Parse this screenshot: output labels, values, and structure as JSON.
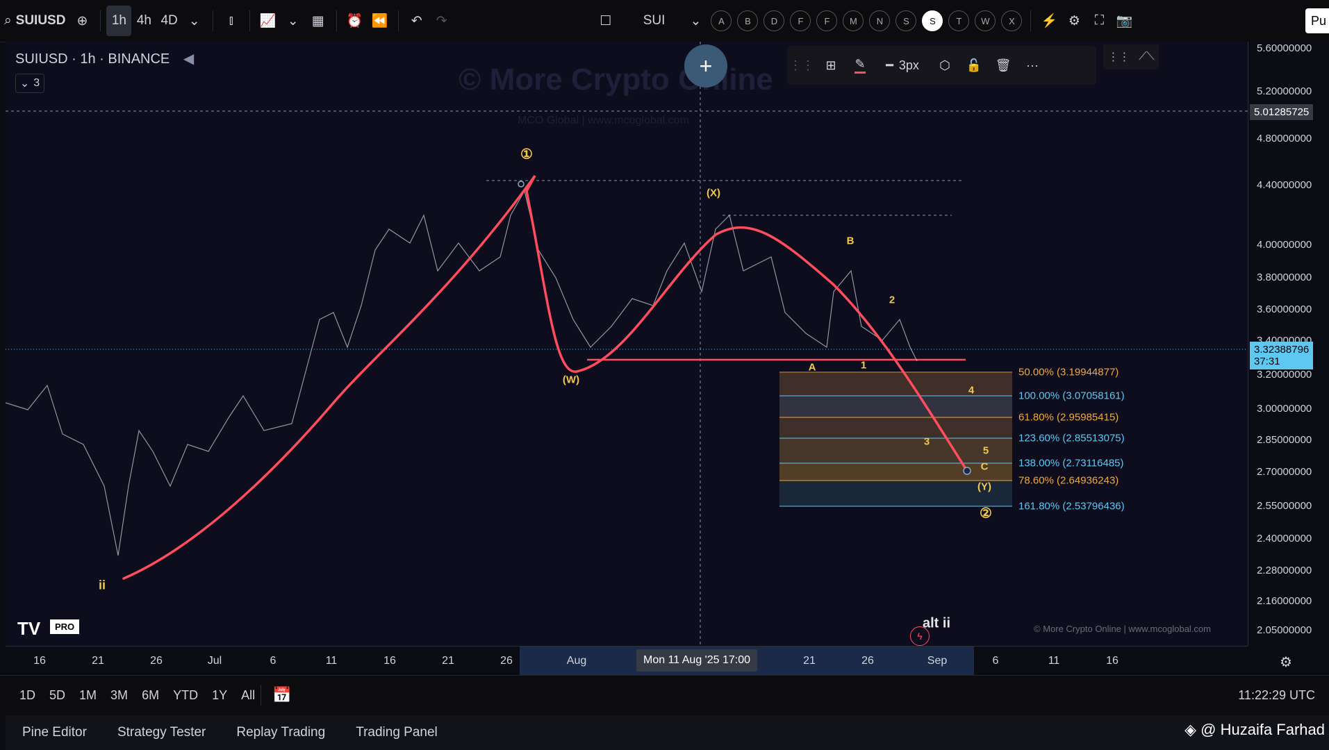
{
  "topbar": {
    "symbol": "SUIUSD",
    "intervals": [
      "1h",
      "4h",
      "4D"
    ],
    "active_interval": "1h",
    "symbol_short": "SUI",
    "letters": [
      "A",
      "B",
      "D",
      "F",
      "F",
      "M",
      "N",
      "S",
      "S",
      "T",
      "W",
      "X"
    ],
    "selected_letter_index": 8,
    "publish": "Pu"
  },
  "legend": {
    "title": "SUIUSD · 1h · BINANCE",
    "collapse": "3"
  },
  "drawing_toolbar": {
    "width_label": "3px"
  },
  "watermark": {
    "main": "© More Crypto Online",
    "sub": "MCO Global  |  www.mcoglobal.com"
  },
  "price_axis": {
    "ticks": [
      "5.60000000",
      "5.20000000",
      "4.80000000",
      "4.40000000",
      "4.00000000",
      "3.80000000",
      "3.60000000",
      "3.40000000",
      "3.20000000",
      "3.00000000",
      "2.85000000",
      "2.70000000",
      "2.55000000",
      "2.40000000",
      "2.28000000",
      "2.16000000",
      "2.05000000"
    ],
    "crosshair_price": "5.01285725",
    "last_price": "3.32388796",
    "countdown": "37:31"
  },
  "time_axis": {
    "ticks": [
      "16",
      "21",
      "26",
      "Jul",
      "6",
      "11",
      "16",
      "21",
      "26",
      "Aug",
      "21",
      "26",
      "Sep",
      "6",
      "11",
      "16"
    ],
    "crosshair_label": "Mon 11 Aug '25   17:00"
  },
  "waves": {
    "w1": "①",
    "w2": "②",
    "X": "(X)",
    "W": "(W)",
    "Y": "(Y)",
    "B": "B",
    "A": "A",
    "C": "C",
    "n1": "1",
    "n2": "2",
    "n3": "3",
    "n4": "4",
    "n5": "5",
    "ii": "ii",
    "alt": "alt ii"
  },
  "fib_levels": [
    {
      "label": "50.00% (3.19944877)",
      "color": "#f2a93b"
    },
    {
      "label": "100.00% (3.07058161)",
      "color": "#5ec8f2"
    },
    {
      "label": "61.80% (2.95985415)",
      "color": "#f2a93b"
    },
    {
      "label": "123.60% (2.85513075)",
      "color": "#5ec8f2"
    },
    {
      "label": "138.00% (2.73116485)",
      "color": "#5ec8f2"
    },
    {
      "label": "78.60% (2.64936243)",
      "color": "#f2a93b"
    },
    {
      "label": "161.80% (2.53796436)",
      "color": "#5ec8f2"
    }
  ],
  "chart_footer": {
    "copyright": "© More Crypto Online  |  www.mcoglobal.com",
    "logo": "TV",
    "pro": "PRO"
  },
  "range_bar": {
    "ranges": [
      "1D",
      "5D",
      "1M",
      "3M",
      "6M",
      "YTD",
      "1Y",
      "All"
    ],
    "clock": "11:22:29 UTC"
  },
  "bottom_bar": {
    "tabs": [
      "Pine Editor",
      "Strategy Tester",
      "Replay Trading",
      "Trading Panel"
    ],
    "author": "@ Huzaifa Farhad"
  },
  "colors": {
    "wave_line": "#ff4d5e",
    "candle": "#b8b8c0",
    "label_yellow": "#f2c94c",
    "fib_orange": "#f2a93b",
    "fib_blue": "#5ec8f2"
  }
}
